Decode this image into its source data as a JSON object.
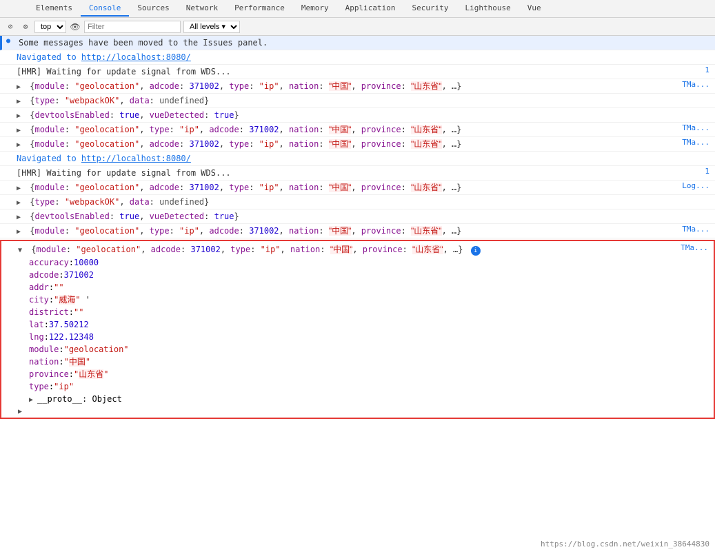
{
  "tabs": {
    "items": [
      "Elements",
      "Console",
      "Sources",
      "Network",
      "Performance",
      "Memory",
      "Application",
      "Security",
      "Lighthouse",
      "Vue"
    ]
  },
  "active_tab": "Console",
  "console": {
    "top_label": "top",
    "filter_placeholder": "Filter",
    "levels_label": "All levels ▾",
    "issues_message": "Some messages have been moved to the Issues panel.",
    "messages": [
      {
        "type": "navigated",
        "text": "Navigated to http://localhost:8080/",
        "source": ""
      },
      {
        "type": "log",
        "text": "[HMR] Waiting for update signal from WDS...",
        "source": ""
      },
      {
        "type": "object",
        "text": "▶ {module: \"geolocation\", adcode: 371002, type: \"ip\", nation: \"中国\", province: \"山东省\", …}",
        "source": "TMa..."
      },
      {
        "type": "object",
        "text": "▶ {type: \"webpackOK\", data: undefined}",
        "source": ""
      },
      {
        "type": "object",
        "text": "▶ {devtoolsEnabled: true, vueDetected: true}",
        "source": ""
      },
      {
        "type": "object",
        "text": "▶ {module: \"geolocation\", type: \"ip\", adcode: 371002, nation: \"中国\", province: \"山东省\", …}",
        "source": "TMa..."
      },
      {
        "type": "object",
        "text": "▶ {module: \"geolocation\", adcode: 371002, type: \"ip\", nation: \"中国\", province: \"山东省\", …}",
        "source": "TMa..."
      },
      {
        "type": "navigated2",
        "text": "Navigated to http://localhost:8080/",
        "source": ""
      },
      {
        "type": "log",
        "text": "[HMR] Waiting for update signal from WDS...",
        "source": ""
      },
      {
        "type": "object",
        "text": "▶ {module: \"geolocation\", adcode: 371002, type: \"ip\", nation: \"中国\", province: \"山东省\", …}",
        "source": "Log..."
      },
      {
        "type": "object",
        "text": "▶ {type: \"webpackOK\", data: undefined}",
        "source": ""
      },
      {
        "type": "object",
        "text": "▶ {devtoolsEnabled: true, vueDetected: true}",
        "source": ""
      },
      {
        "type": "object",
        "text": "▶ {module: \"geolocation\", type: \"ip\", adcode: 371002, nation: \"中国\", province: \"山东省\", …}",
        "source": "TMa..."
      }
    ],
    "expanded_object": {
      "header": "▼ {module: \"geolocation\", adcode: 371002, type: \"ip\", nation: \"中国\", province: \"山东省\", …}",
      "source": "TMa...",
      "fields": [
        {
          "key": "accuracy",
          "value": "10000",
          "type": "number"
        },
        {
          "key": "adcode",
          "value": "371002",
          "type": "number"
        },
        {
          "key": "addr",
          "value": "\"\"",
          "type": "string"
        },
        {
          "key": "city",
          "value": "\"威海\"",
          "type": "string"
        },
        {
          "key": "district",
          "value": "\"\"",
          "type": "string"
        },
        {
          "key": "lat",
          "value": "37.50212",
          "type": "number"
        },
        {
          "key": "lng",
          "value": "122.12348",
          "type": "number"
        },
        {
          "key": "module",
          "value": "\"geolocation\"",
          "type": "string"
        },
        {
          "key": "nation",
          "value": "\"中国\"",
          "type": "string_cn"
        },
        {
          "key": "province",
          "value": "\"山东省\"",
          "type": "string_cn"
        },
        {
          "key": "type",
          "value": "\"ip\"",
          "type": "string"
        }
      ],
      "proto": "__proto__: Object"
    }
  },
  "watermark": "https://blog.csdn.net/weixin_38644830"
}
